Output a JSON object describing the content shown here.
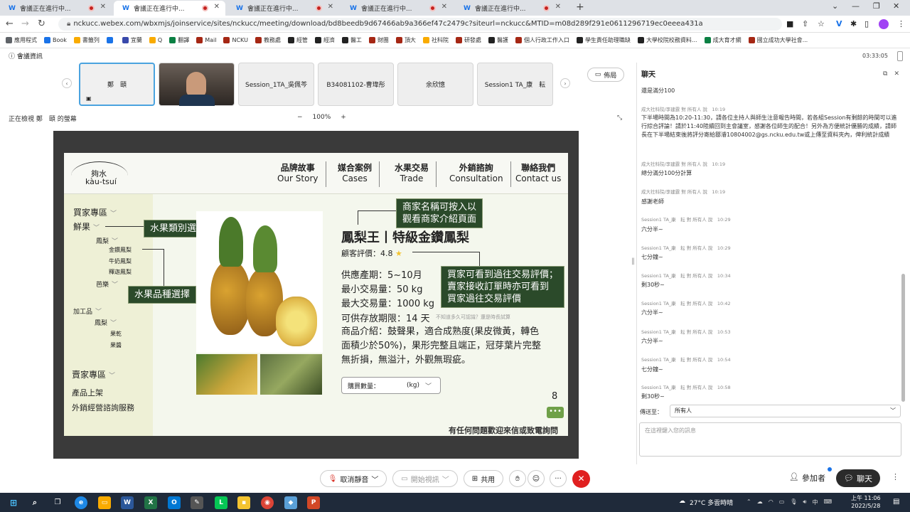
{
  "tabs": [
    {
      "label": "會議正在進行中..."
    },
    {
      "label": "會議正在進行中..."
    },
    {
      "label": "會議正在進行中..."
    },
    {
      "label": "會議正在進行中..."
    },
    {
      "label": "會議正在進行中..."
    }
  ],
  "address": {
    "url": "nckucc.webex.com/wbxmjs/joinservice/sites/nckucc/meeting/download/bd8beedb9d67466ab9a366ef47c2479c?siteurl=nckucc&MTID=m08d289f291e0611296719ec0eeea431a"
  },
  "bookmarks": [
    "應用程式",
    "Book",
    "書籤列",
    "",
    "宜蘭",
    "Q",
    "翻譯",
    "Mail",
    "NCKU",
    "教務處",
    "經管",
    "經濟",
    "醫工",
    "財團",
    "頂大",
    "社科院",
    "研發處",
    "醫護",
    "個人行政工作入口",
    "學生責任助理職缺",
    "大學校院校務資料...",
    "成大育才網",
    "國立成功大學社會..."
  ],
  "meeting": {
    "info_label": "會議資訊",
    "time": "03:33:05",
    "layout_label": "佈局"
  },
  "thumbnails": [
    "鄭　頤",
    "",
    "Session_1TA_吳佩芩",
    "B34081102-曹瑋彤",
    "余欣憶",
    "Session1 TA_康　耘"
  ],
  "viewing": {
    "text": "正在檢視 鄭　頤 的螢幕",
    "zoom": "100%",
    "minus": "−",
    "plus": "+"
  },
  "slide": {
    "logo_cn": "夠水",
    "logo_en": "kàu-tsuí",
    "menu": [
      {
        "cn": "品牌故事",
        "en": "Our Story"
      },
      {
        "cn": "媒合案例",
        "en": "Cases"
      },
      {
        "cn": "水果交易",
        "en": "Trade"
      },
      {
        "cn": "外銷諮詢",
        "en": "Consultation"
      },
      {
        "cn": "聯絡我們",
        "en": "Contact us"
      }
    ],
    "side": {
      "buyer": "買家專區",
      "fresh": "鮮果",
      "pineapple": "鳳梨",
      "p1": "金鑽鳳梨",
      "p2": "牛奶鳳梨",
      "p3": "釋迦鳳梨",
      "banana": "芭樂",
      "processed": "加工品",
      "pineapple2": "鳳梨",
      "dried": "果乾",
      "jam": "果醬",
      "seller": "賣家專區",
      "listing": "產品上架",
      "export": "外銷經營諮詢服務"
    },
    "callouts": {
      "fruit_type": "水果類別選擇",
      "variety": "水果品種選擇",
      "seller_name": "商家名稱可按入以\n觀看商家介紹頁面",
      "rating": "買家可看到過往交易評價；\n賣家接收訂單時亦可看到\n買家過往交易評價"
    },
    "product_title": "鳳梨王丨特級金鑽鳳梨",
    "rating_label": "顧客評價：4.8",
    "star": "★",
    "specs": [
      "供應產期：5~10月",
      "最小交易量：50 kg",
      "最大交易量：1000 kg",
      "可供存放期限：14 天"
    ],
    "note": "不知道多久可認識？還是時長試算",
    "desc": "商品介紹：鼓聲果，適合成熟度(果皮微黃，轉色面積少於50%)，果形完整且端正，冠芽葉片完整無折損，無溢汁，外觀無瑕疵。",
    "qty_label": "購買數量：",
    "qty_unit": "(kg)",
    "page": "8",
    "chat_icon": "•••",
    "footer": "有任何問題歡迎來信或致電詢問"
  },
  "chat": {
    "title": "聊天",
    "messages": [
      {
        "meta": "",
        "text": "還是滿分100"
      },
      {
        "meta": "成大社科院/李建霆 對 所有人 說　10:19",
        "text": "下半場時間為10:20-11:30，請各位主持人與師生注意報告時間，若各組Session有剩餘的時間可以進行綜合評論！請於11:40陸續回到主會議室，感謝各位師生的配合！另外為方便統計優勝的成績，請師長在下半場結束後將評分寄給鄒濬10804002@gs.ncku.edu.tw或上傳至資料夾內，俾利統計成績"
      },
      {
        "meta": "成大社科院/李建霆 對 所有人 說　10:19",
        "text": "總分滿分100分計算"
      },
      {
        "meta": "成大社科院/李建霆 對 所有人 說　10:19",
        "text": "感謝老師"
      },
      {
        "meta": "Session1 TA_康　耘 對 所有人 說　10:29",
        "text": "六分半~"
      },
      {
        "meta": "Session1 TA_康　耘 對 所有人 說　10:29",
        "text": "七分鐘~"
      },
      {
        "meta": "Session1 TA_康　耘 對 所有人 說　10:34",
        "text": "剩30秒~"
      },
      {
        "meta": "Session1 TA_康　耘 對 所有人 說　10:42",
        "text": "六分半~"
      },
      {
        "meta": "Session1 TA_康　耘 對 所有人 說　10:53",
        "text": "六分半~"
      },
      {
        "meta": "Session1 TA_康　耘 對 所有人 說　10:54",
        "text": "七分鐘~"
      },
      {
        "meta": "Session1 TA_康　耘 對 所有人 說　10:58",
        "text": "剩30秒~"
      }
    ],
    "send_to_label": "傳送至：",
    "send_to_value": "所有人",
    "placeholder": "在這裡鍵入您的訊息"
  },
  "controls": {
    "mute": "取消靜音",
    "video": "開始視訊",
    "share": "共用",
    "participants": "參加者",
    "chat": "聊天"
  },
  "taskbar": {
    "weather": "27°C  多雲時晴",
    "ime": "中",
    "time": "上午 11:06",
    "date": "2022/5/28"
  },
  "colors": {
    "accent": "#1a73e8",
    "callout": "#2b4a2a",
    "leave": "#e02020",
    "sidebar": "#eef0d6"
  }
}
